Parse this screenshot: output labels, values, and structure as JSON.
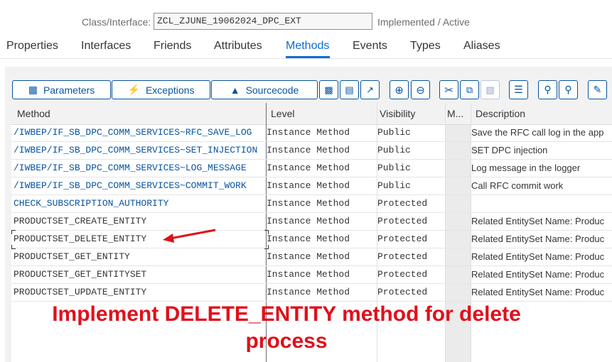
{
  "header": {
    "class_label": "Class/Interface:",
    "class_value": "ZCL_ZJUNE_19062024_DPC_EXT",
    "status": "Implemented / Active"
  },
  "tabs": [
    {
      "label": "Properties"
    },
    {
      "label": "Interfaces"
    },
    {
      "label": "Friends"
    },
    {
      "label": "Attributes"
    },
    {
      "label": "Methods",
      "active": true
    },
    {
      "label": "Events"
    },
    {
      "label": "Types"
    },
    {
      "label": "Aliases"
    }
  ],
  "toolbar": {
    "parameters": "Parameters",
    "exceptions": "Exceptions",
    "sourcecode": "Sourcecode",
    "icons": [
      "hierarchy-icon",
      "document-icon",
      "expand-icon",
      "zoom-in-icon",
      "zoom-out-icon",
      "cut-icon",
      "copy-icon",
      "paste-icon",
      "filter-icon",
      "search-icon",
      "search-next-icon",
      "edit-icon"
    ]
  },
  "table": {
    "columns": [
      "Method",
      "Level",
      "Visibility",
      "M...",
      "Description"
    ],
    "rows": [
      {
        "method": "/IWBEP/IF_SB_DPC_COMM_SERVICES~RFC_SAVE_LOG",
        "level": "Instance Method",
        "visibility": "Public",
        "description": "Save the RFC call log in the app",
        "link": true
      },
      {
        "method": "/IWBEP/IF_SB_DPC_COMM_SERVICES~SET_INJECTION",
        "level": "Instance Method",
        "visibility": "Public",
        "description": "SET DPC injection",
        "link": true
      },
      {
        "method": "/IWBEP/IF_SB_DPC_COMM_SERVICES~LOG_MESSAGE",
        "level": "Instance Method",
        "visibility": "Public",
        "description": "Log message in the logger",
        "link": true
      },
      {
        "method": "/IWBEP/IF_SB_DPC_COMM_SERVICES~COMMIT_WORK",
        "level": "Instance Method",
        "visibility": "Public",
        "description": "Call RFC commit work",
        "link": true
      },
      {
        "method": "CHECK_SUBSCRIPTION_AUTHORITY",
        "level": "Instance Method",
        "visibility": "Protected",
        "description": "",
        "link": true
      },
      {
        "method": "PRODUCTSET_CREATE_ENTITY",
        "level": "Instance Method",
        "visibility": "Protected",
        "description": "Related EntitySet Name: Produc",
        "link": false
      },
      {
        "method": "PRODUCTSET_DELETE_ENTITY",
        "level": "Instance Method",
        "visibility": "Protected",
        "description": "Related EntitySet Name: Produc",
        "link": false
      },
      {
        "method": "PRODUCTSET_GET_ENTITY",
        "level": "Instance Method",
        "visibility": "Protected",
        "description": "Related EntitySet Name: Produc",
        "link": false
      },
      {
        "method": "PRODUCTSET_GET_ENTITYSET",
        "level": "Instance Method",
        "visibility": "Protected",
        "description": "Related EntitySet Name: Produc",
        "link": false
      },
      {
        "method": "PRODUCTSET_UPDATE_ENTITY",
        "level": "Instance Method",
        "visibility": "Protected",
        "description": "Related EntitySet Name: Produc",
        "link": false
      }
    ]
  },
  "annotation": {
    "line1": "Implement DELETE_ENTITY method for delete",
    "line2": "process",
    "arrow_color": "#e0101b"
  },
  "colors": {
    "accent": "#0a6ed1",
    "link": "#0854a0",
    "annotation": "#e0101b"
  }
}
